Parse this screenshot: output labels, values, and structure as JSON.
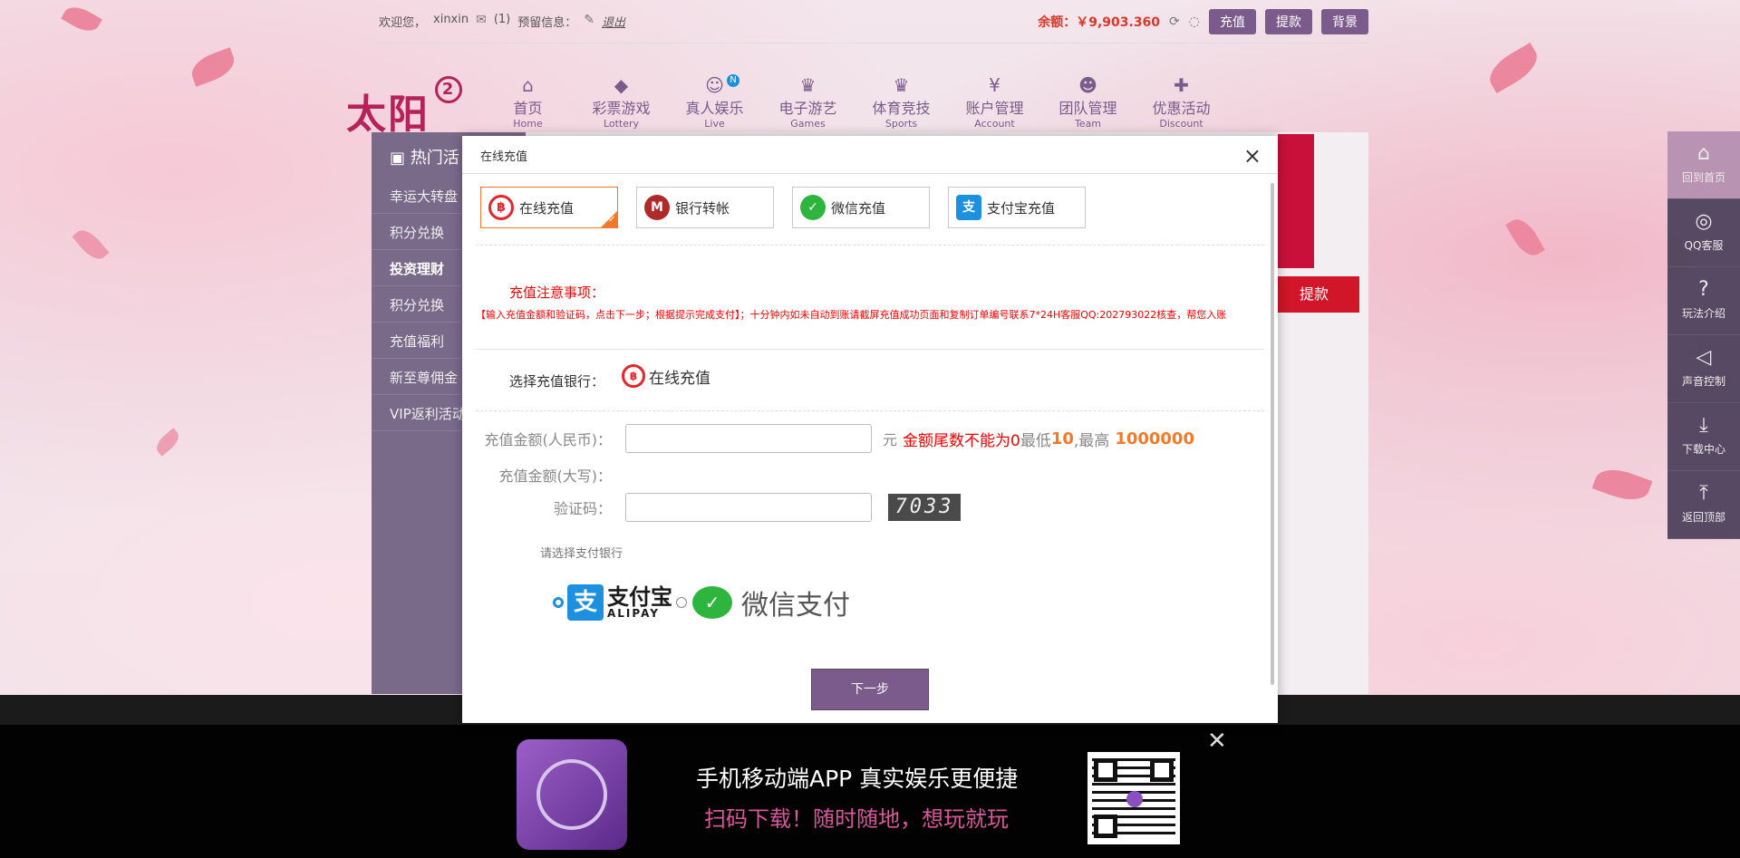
{
  "topbar": {
    "welcome": "欢迎您，",
    "username": "xinxin",
    "mail_count": "(1)",
    "notice_label": "预留信息：",
    "logout": "退出",
    "balance_label": "余额：",
    "balance_value": "￥9,903.360",
    "deposit": "充值",
    "withdraw": "提款",
    "background": "背景"
  },
  "logo": {
    "text": "太阳",
    "circle": "2"
  },
  "nav": [
    {
      "zh": "首页",
      "en": "Home",
      "icon": "home-icon"
    },
    {
      "zh": "彩票游戏",
      "en": "Lottery",
      "icon": "lottery-icon"
    },
    {
      "zh": "真人娱乐",
      "en": "Live",
      "icon": "live-icon",
      "badge": "N"
    },
    {
      "zh": "电子游艺",
      "en": "Games",
      "icon": "trophy-icon"
    },
    {
      "zh": "体育竞技",
      "en": "Sports",
      "icon": "trophy-icon"
    },
    {
      "zh": "账户管理",
      "en": "Account",
      "icon": "yen-icon"
    },
    {
      "zh": "团队管理",
      "en": "Team",
      "icon": "team-icon"
    },
    {
      "zh": "优惠活动",
      "en": "Discount",
      "icon": "gift-icon"
    }
  ],
  "sidebar": {
    "title": "热门活",
    "items": [
      "幸运大转盘",
      "积分兑换",
      "投资理财",
      "积分兑换",
      "充值福利",
      "新至尊佣金",
      "VIP返利活动"
    ]
  },
  "bg_withdraw": "提款",
  "floatbar": [
    "回到首页",
    "QQ客服",
    "玩法介绍",
    "声音控制",
    "下载中心",
    "返回顶部"
  ],
  "modal": {
    "title": "在线充值",
    "tabs": [
      "在线充值",
      "银行转帐",
      "微信充值",
      "支付宝充值"
    ],
    "notice_title": "充值注意事项：",
    "notice_text": "【输入充值金额和验证码，点击下一步；根据提示完成支付】；十分钟内如未自动到账请截屏充值成功页面和复制订单编号联系7*24H客服QQ:202793022核查，帮您入账",
    "choose_bank_label": "选择充值银行：",
    "choose_bank_value": "在线充值",
    "amount_label": "充值金额(人民币)：",
    "amount_value": "",
    "unit": "元",
    "rule_text": "金额尾数不能为0",
    "min_label": "最低",
    "min_value": "10",
    "max_label": ",最高",
    "max_value": "1000000",
    "amount_upper_label": "充值金额(大写)：",
    "captcha_label": "验证码：",
    "captcha_value": "",
    "captcha_image": "7033",
    "pay_hint": "请选择支付银行",
    "alipay_zh": "支付宝",
    "alipay_en": "ALIPAY",
    "wechat_pay": "微信支付",
    "next": "下一步"
  },
  "app_banner": {
    "line1": "手机移动端APP 真实娱乐更便捷",
    "line2": "扫码下载！随时随地，想玩就玩"
  },
  "colors": {
    "accent": "#7b5a8c",
    "danger": "#e00000",
    "orange": "#f07a2a",
    "wechat": "#2db53d",
    "alipay": "#1e90e0"
  }
}
